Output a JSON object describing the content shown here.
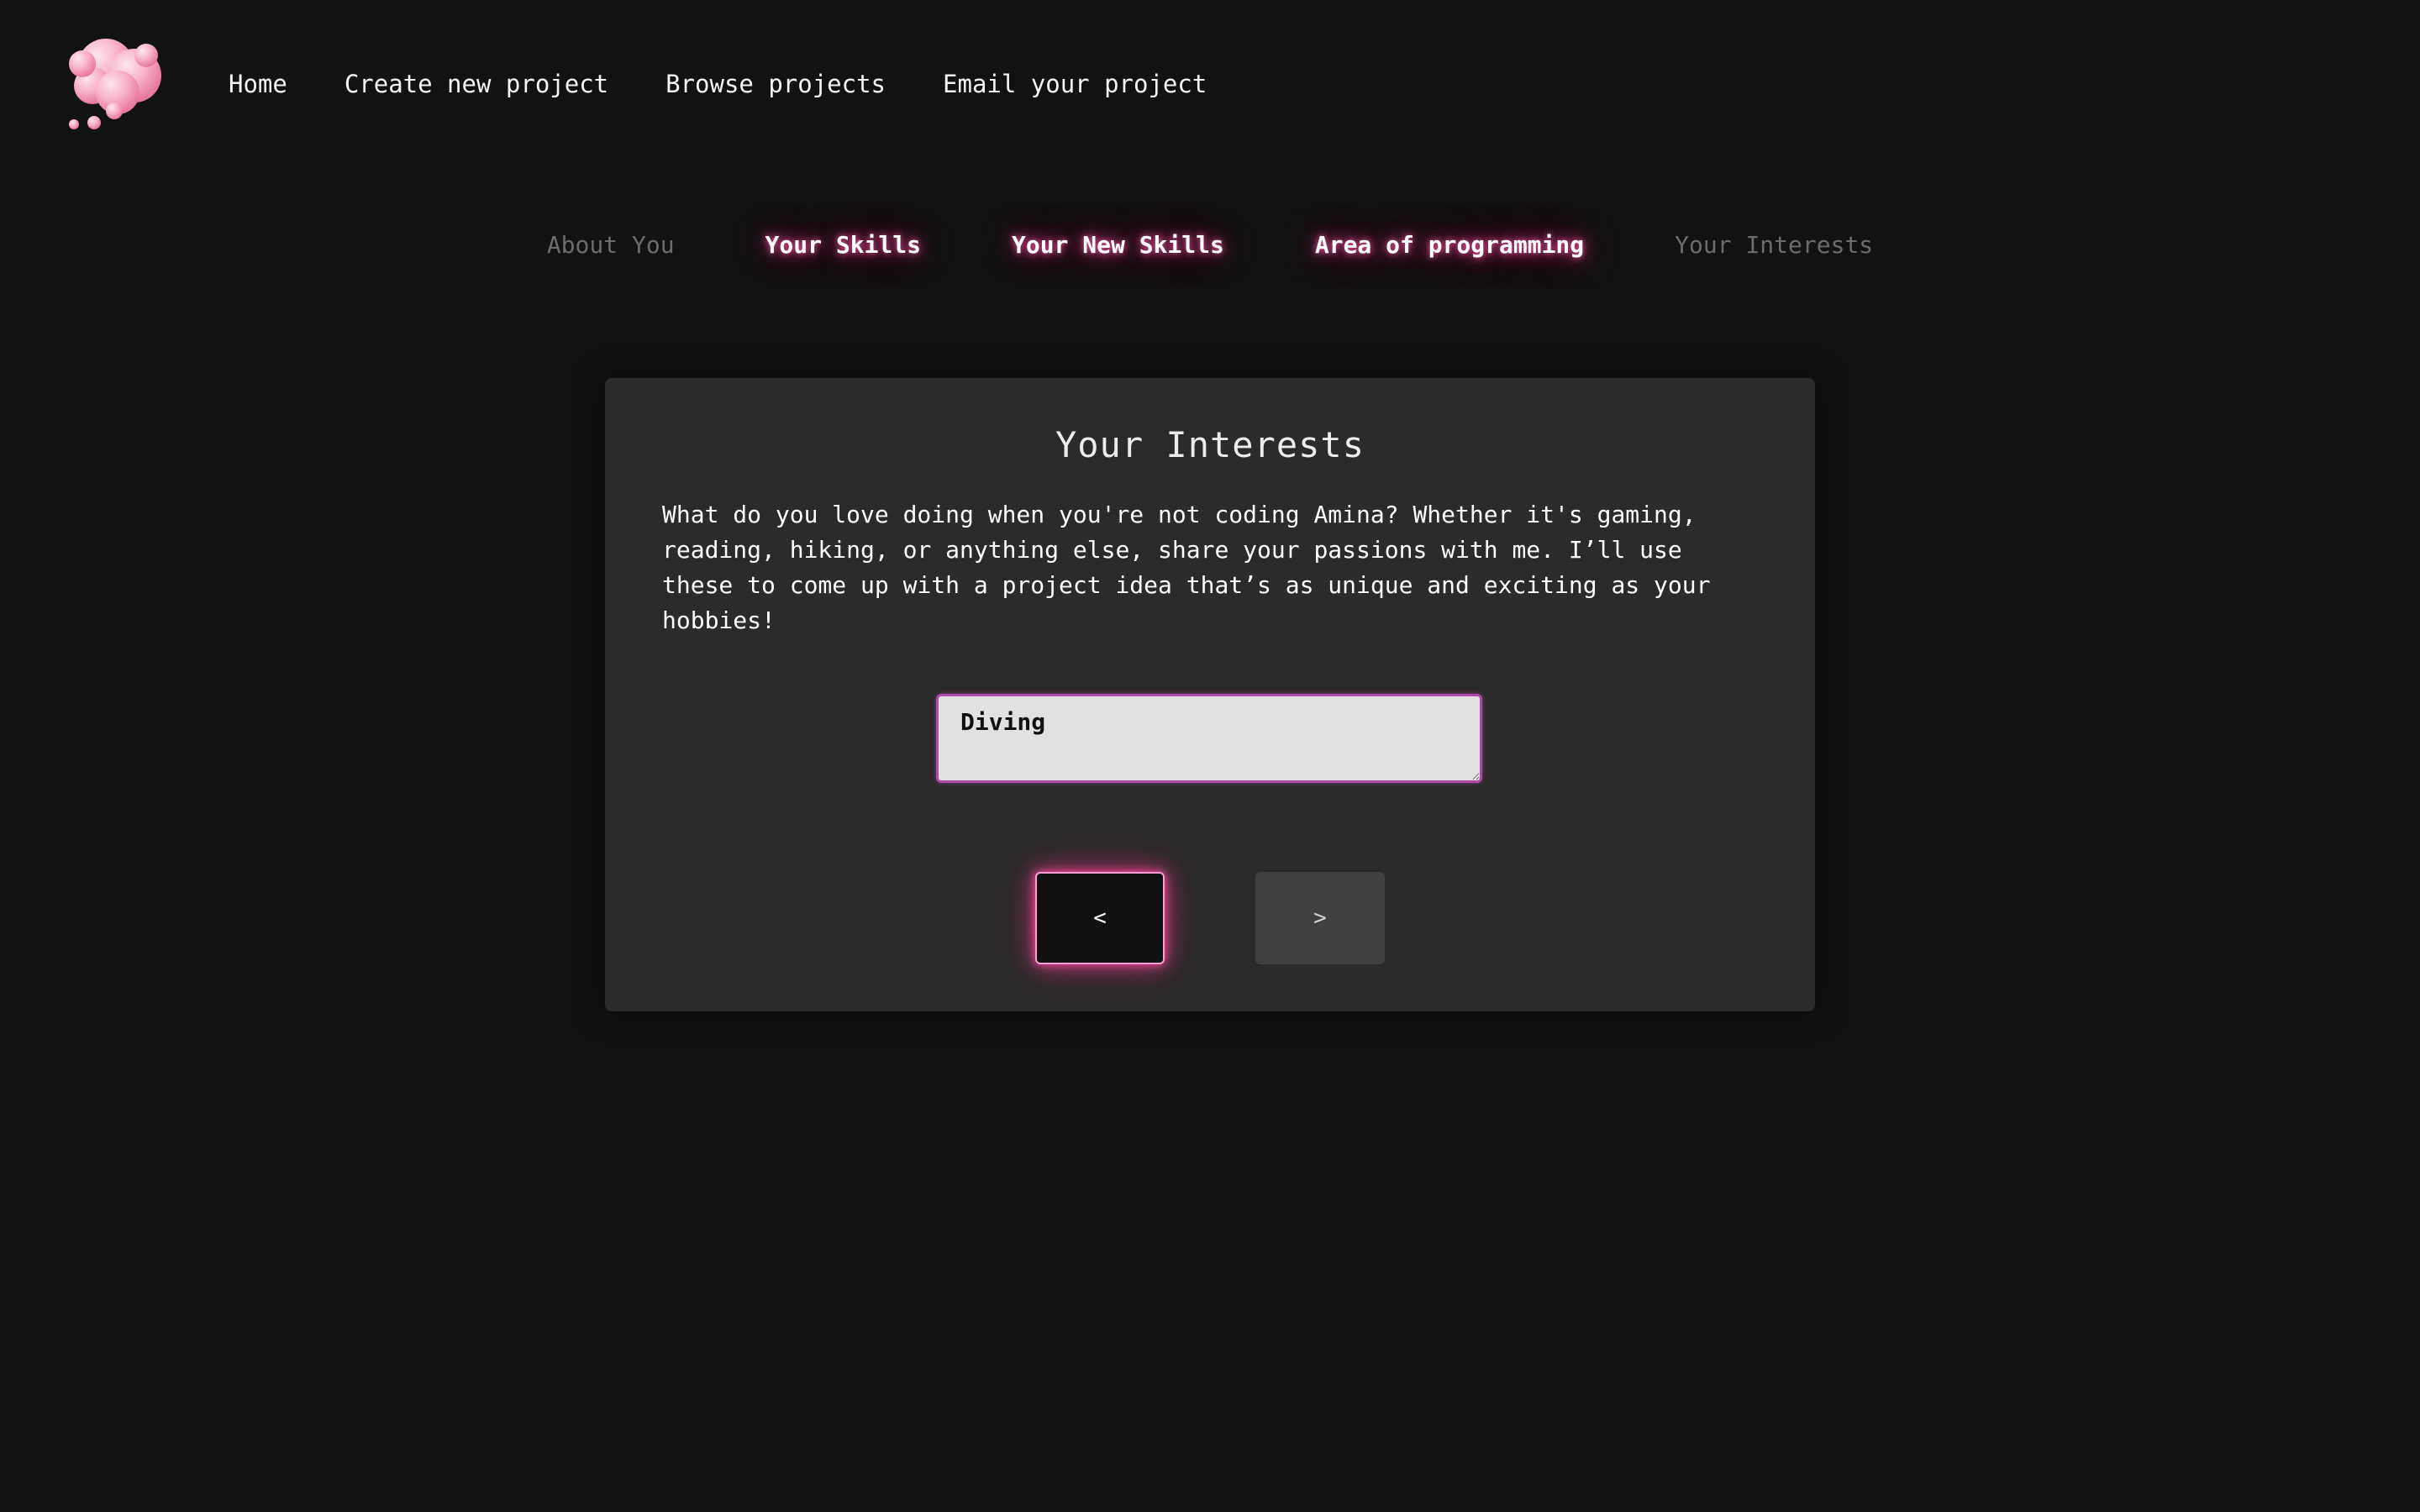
{
  "nav": {
    "logo_icon": "thought-cloud-logo-icon",
    "items": [
      {
        "label": "Home"
      },
      {
        "label": "Create new project"
      },
      {
        "label": "Browse projects"
      },
      {
        "label": "Email your project"
      }
    ]
  },
  "steps": [
    {
      "label": "About You",
      "state": "inactive"
    },
    {
      "label": "Your Skills",
      "state": "done"
    },
    {
      "label": "Your New Skills",
      "state": "done"
    },
    {
      "label": "Area of programming",
      "state": "done"
    },
    {
      "label": "Your Interests",
      "state": "inactive"
    }
  ],
  "card": {
    "title": "Your Interests",
    "description": "What do you love doing when you're not coding Amina? Whether it's gaming, reading, hiking, or anything else, share your passions with me. I’ll use these to come up with a project idea that’s as unique and exciting as your hobbies!",
    "input_value": "Diving",
    "back_label": "<",
    "next_label": ">"
  },
  "colors": {
    "background": "#121212",
    "card": "#2b2b2b",
    "accent_glow": "#ff4fa0",
    "input_border": "#b04aa8",
    "inactive_step": "#6c6c6c"
  }
}
